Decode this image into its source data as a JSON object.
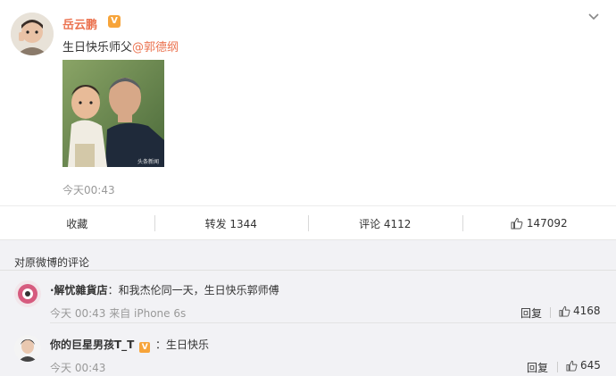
{
  "post": {
    "author": "岳云鹏",
    "verified_badge": "V",
    "text_prefix": "生日快乐师父",
    "mention": "@郭德纲",
    "image_watermark": "头条新闻",
    "time": "今天00:43"
  },
  "actions": {
    "favorite_label": "收藏",
    "repost_label": "转发 1344",
    "comment_label": "评论 4112",
    "like_count": "147092"
  },
  "comments": {
    "header": "对原微博的评论",
    "items": [
      {
        "name": "·解忧雜貨店",
        "text": "：和我杰伦同一天，生日快乐郭师傅",
        "meta": "今天 00:43 来自 iPhone 6s",
        "reply": "回复",
        "likes": "4168"
      },
      {
        "name": "你的巨星男孩T_T",
        "badge": "V",
        "text": "：生日快乐",
        "meta": "今天 00:43",
        "reply": "回复",
        "likes": "645"
      }
    ]
  },
  "colors": {
    "accent": "#eb7350",
    "badge": "#f7a43a",
    "muted": "#999999"
  }
}
